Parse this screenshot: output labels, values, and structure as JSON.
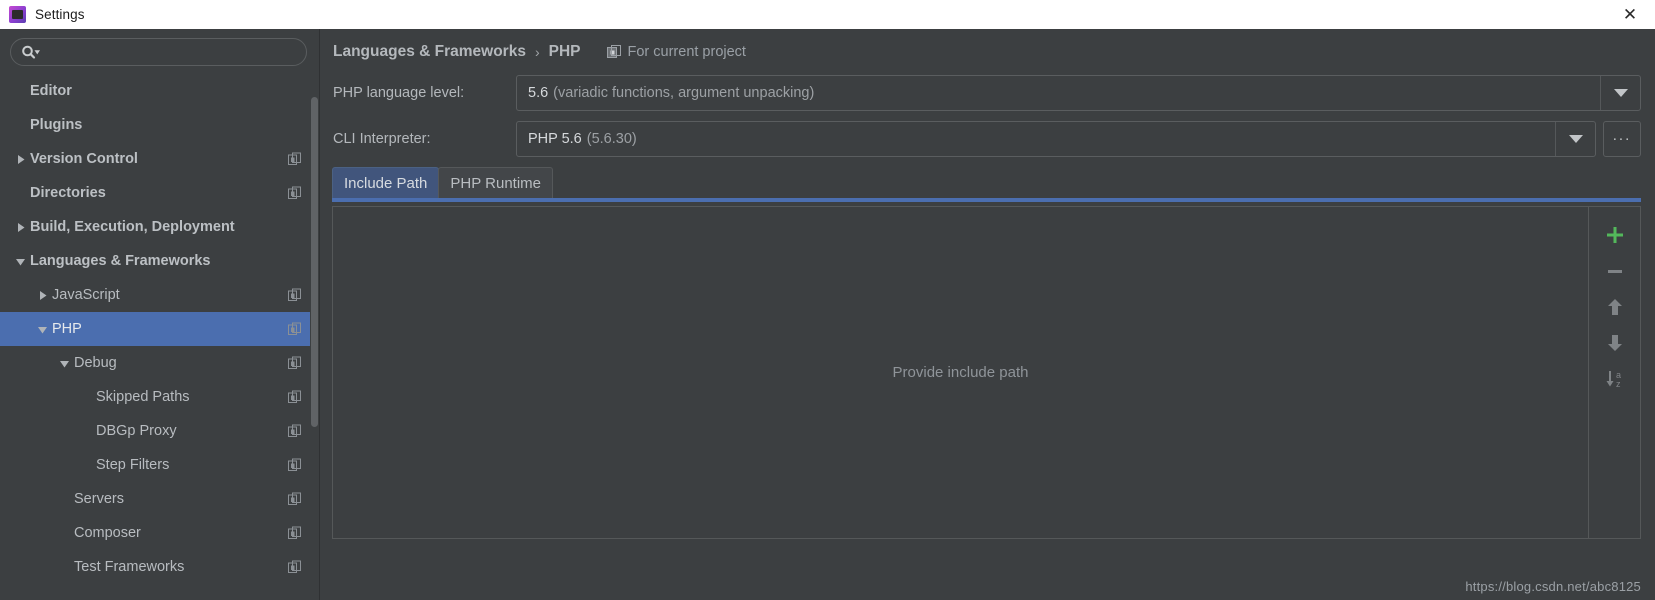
{
  "window": {
    "title": "Settings",
    "app_icon": "jetbrains-app-icon",
    "close_label": "✕"
  },
  "sidebar": {
    "search": {
      "value": "",
      "placeholder": "",
      "icon": "search-icon"
    },
    "items": [
      {
        "label": "Editor",
        "depth": 0,
        "bold": true,
        "twisty": "none",
        "copy": false,
        "selected": false
      },
      {
        "label": "Plugins",
        "depth": 0,
        "bold": true,
        "twisty": "none",
        "copy": false,
        "selected": false
      },
      {
        "label": "Version Control",
        "depth": 0,
        "bold": true,
        "twisty": "collapsed",
        "copy": true,
        "selected": false
      },
      {
        "label": "Directories",
        "depth": 0,
        "bold": true,
        "twisty": "none",
        "copy": true,
        "selected": false
      },
      {
        "label": "Build, Execution, Deployment",
        "depth": 0,
        "bold": true,
        "twisty": "collapsed",
        "copy": false,
        "selected": false
      },
      {
        "label": "Languages & Frameworks",
        "depth": 0,
        "bold": true,
        "twisty": "expanded",
        "copy": false,
        "selected": false
      },
      {
        "label": "JavaScript",
        "depth": 1,
        "bold": false,
        "twisty": "collapsed",
        "copy": true,
        "selected": false
      },
      {
        "label": "PHP",
        "depth": 1,
        "bold": false,
        "twisty": "expanded",
        "copy": true,
        "selected": true
      },
      {
        "label": "Debug",
        "depth": 2,
        "bold": false,
        "twisty": "expanded",
        "copy": true,
        "selected": false
      },
      {
        "label": "Skipped Paths",
        "depth": 3,
        "bold": false,
        "twisty": "none",
        "copy": true,
        "selected": false
      },
      {
        "label": "DBGp Proxy",
        "depth": 3,
        "bold": false,
        "twisty": "none",
        "copy": true,
        "selected": false
      },
      {
        "label": "Step Filters",
        "depth": 3,
        "bold": false,
        "twisty": "none",
        "copy": true,
        "selected": false
      },
      {
        "label": "Servers",
        "depth": 2,
        "bold": false,
        "twisty": "none",
        "copy": true,
        "selected": false
      },
      {
        "label": "Composer",
        "depth": 2,
        "bold": false,
        "twisty": "none",
        "copy": true,
        "selected": false
      },
      {
        "label": "Test Frameworks",
        "depth": 2,
        "bold": false,
        "twisty": "none",
        "copy": true,
        "selected": false
      }
    ]
  },
  "breadcrumb": {
    "root": "Languages & Frameworks",
    "separator": "›",
    "leaf": "PHP",
    "scope_icon": "project-scope-icon",
    "scope_text": "For current project"
  },
  "fields": [
    {
      "label": "PHP language level:",
      "value_strong": "5.6",
      "value_muted": "(variadic functions, argument unpacking)",
      "has_ellipsis": false
    },
    {
      "label": "CLI Interpreter:",
      "value_strong": "PHP 5.6",
      "value_muted": "(5.6.30)",
      "has_ellipsis": true,
      "ellipsis_label": "..."
    }
  ],
  "tabs": [
    {
      "label": "Include Path",
      "active": true
    },
    {
      "label": "PHP Runtime",
      "active": false
    }
  ],
  "content": {
    "placeholder": "Provide include path"
  },
  "toolbar": [
    {
      "name": "add-button",
      "icon": "plus-icon",
      "enabled": true
    },
    {
      "name": "remove-button",
      "icon": "minus-icon",
      "enabled": false
    },
    {
      "name": "move-up-button",
      "icon": "arrow-up-icon",
      "enabled": false
    },
    {
      "name": "move-down-button",
      "icon": "arrow-down-icon",
      "enabled": false
    },
    {
      "name": "sort-button",
      "icon": "sort-az-icon",
      "enabled": false
    }
  ],
  "watermark": "https://blog.csdn.net/abc8125",
  "colors": {
    "accent": "#4b6eaf",
    "panel": "#3c3f41",
    "add_green": "#53b85b",
    "titlebar": "#ffffff"
  }
}
